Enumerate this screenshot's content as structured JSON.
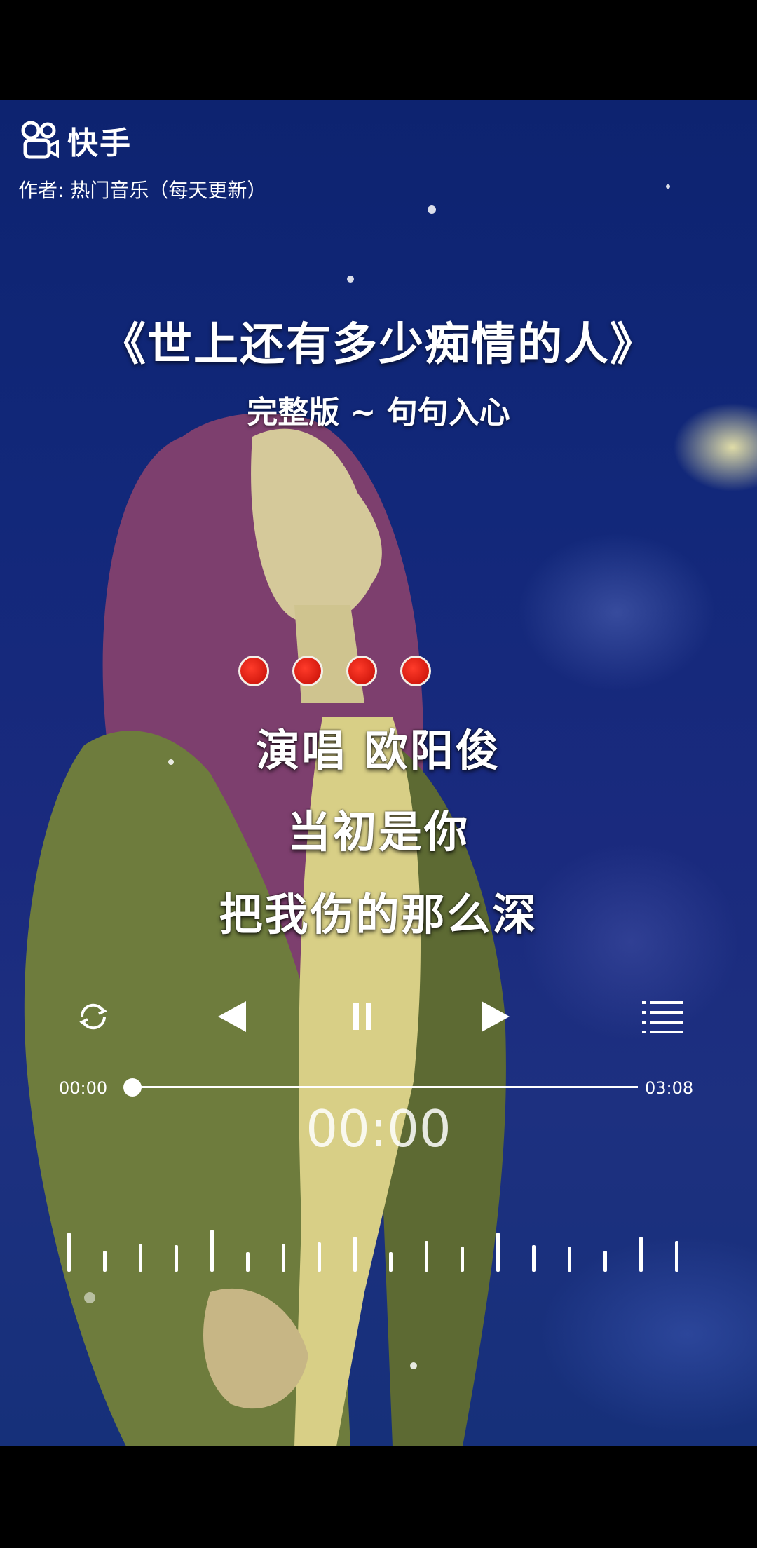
{
  "app": {
    "name": "快手"
  },
  "author_line": "作者: 热门音乐（每天更新）",
  "song": {
    "title": "《世上还有多少痴情的人》",
    "subtitle": "完整版 ~ 句句入心"
  },
  "lyrics": [
    "演唱 欧阳俊",
    "当初是你",
    "把我伤的那么深"
  ],
  "indicator_dots": 4,
  "player": {
    "current_time": "00:00",
    "total_time": "03:08",
    "big_time": "00:00",
    "progress": 0,
    "controls": [
      "repeat-icon",
      "previous-icon",
      "pause-icon",
      "next-icon",
      "playlist-icon"
    ]
  },
  "colors": {
    "background": "#12287a",
    "dot_red": "#e2251a",
    "text": "#ffffff"
  }
}
